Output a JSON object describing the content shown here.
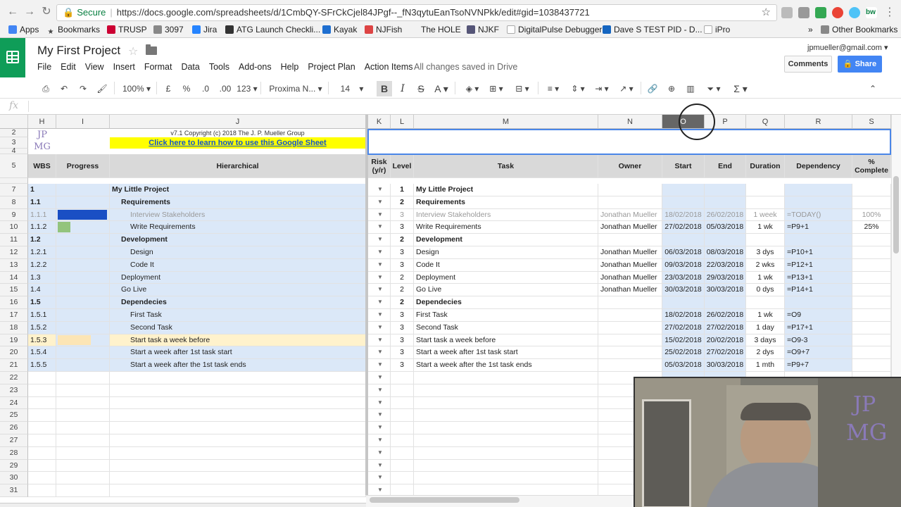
{
  "browser": {
    "secure_label": "Secure",
    "url": "https://docs.google.com/spreadsheets/d/1CmbQY-SFrCkCjel84JPgf--_fN3qytuEanTsoNVNPkk/edit#gid=1038437721",
    "bookmarks": [
      "Apps",
      "Bookmarks",
      "TRUSP",
      "3097",
      "Jira",
      "ATG Launch Checkli...",
      "Kayak",
      "NJFish",
      "The HOLE",
      "NJKF",
      "DigitalPulse Debugger",
      "Dave S TEST PID - D...",
      "iPro"
    ],
    "other_bookmarks": "Other Bookmarks",
    "more": "»"
  },
  "doc": {
    "title": "My First Project",
    "menus": [
      "File",
      "Edit",
      "View",
      "Insert",
      "Format",
      "Data",
      "Tools",
      "Add-ons",
      "Help",
      "Project Plan",
      "Action Items"
    ],
    "saved_status": "All changes saved in Drive",
    "account": "jpmueller@gmail.com",
    "comments_label": "Comments",
    "share_label": "Share"
  },
  "toolbar": {
    "zoom": "100%",
    "currency": "£",
    "percent": "%",
    "dec_less": ".0",
    "dec_more": ".00",
    "format_more": "123",
    "font": "Proxima N...",
    "font_size": "14",
    "bold": "B",
    "italic": "I",
    "strike": "S",
    "text_color": "A",
    "function": "Σ"
  },
  "formula_bar": {
    "fx": "fx"
  },
  "columns": [
    "H",
    "I",
    "J",
    "K",
    "L",
    "M",
    "N",
    "O",
    "P",
    "Q",
    "R",
    "S"
  ],
  "selected_column": "O",
  "header_block": {
    "logo_top": "JP",
    "logo_bottom": "MG",
    "copyright": "v7.1 Copyright (c) 2018 The J. P. Mueller Group",
    "link": "Click here to learn how to use this Google Sheet"
  },
  "table_headers": {
    "wbs": "WBS",
    "progress": "Progress",
    "hierarchical": "Hierarchical",
    "risk": "Risk (y/r)",
    "level": "Level",
    "task": "Task",
    "owner": "Owner",
    "start": "Start",
    "end": "End",
    "duration": "Duration",
    "dependency": "Dependency",
    "complete": "% Complete"
  },
  "rows": [
    {
      "n": "7",
      "wbs": "1",
      "hier": "My Little Project",
      "lvl": "1",
      "task": "My Little Project",
      "owner": "",
      "start": "",
      "end": "",
      "dur": "",
      "dep": "",
      "pct": "",
      "style": "b1"
    },
    {
      "n": "8",
      "wbs": "1.1",
      "hier": "Requirements",
      "lvl": "2",
      "task": "Requirements",
      "owner": "",
      "start": "",
      "end": "",
      "dur": "",
      "dep": "",
      "pct": "",
      "style": "b2"
    },
    {
      "n": "9",
      "wbs": "1.1.1",
      "hier": "Interview Stakeholders",
      "lvl": "3",
      "task": "Interview Stakeholders",
      "owner": "Jonathan Mueller",
      "start": "18/02/2018",
      "end": "26/02/2018",
      "dur": "1 week",
      "dep": "=TODAY()",
      "pct": "100%",
      "style": "gray",
      "progress": 1.0
    },
    {
      "n": "10",
      "wbs": "1.1.2",
      "hier": "Write Requirements",
      "lvl": "3",
      "task": "Write Requirements",
      "owner": "Jonathan Mueller",
      "start": "27/02/2018",
      "end": "05/03/2018",
      "dur": "1 wk",
      "dep": "=P9+1",
      "pct": "25%",
      "style": "n3",
      "progress": 0.25
    },
    {
      "n": "11",
      "wbs": "1.2",
      "hier": "Development",
      "lvl": "2",
      "task": "Development",
      "owner": "",
      "start": "",
      "end": "",
      "dur": "",
      "dep": "",
      "pct": "",
      "style": "b2"
    },
    {
      "n": "12",
      "wbs": "1.2.1",
      "hier": "Design",
      "lvl": "3",
      "task": "Design",
      "owner": "Jonathan Mueller",
      "start": "06/03/2018",
      "end": "08/03/2018",
      "dur": "3 dys",
      "dep": "=P10+1",
      "pct": "",
      "style": "n3"
    },
    {
      "n": "13",
      "wbs": "1.2.2",
      "hier": "Code It",
      "lvl": "3",
      "task": "Code It",
      "owner": "Jonathan Mueller",
      "start": "09/03/2018",
      "end": "22/03/2018",
      "dur": "2 wks",
      "dep": "=P12+1",
      "pct": "",
      "style": "n3"
    },
    {
      "n": "14",
      "wbs": "1.3",
      "hier": "Deployment",
      "lvl": "2",
      "task": "Deployment",
      "owner": "Jonathan Mueller",
      "start": "23/03/2018",
      "end": "29/03/2018",
      "dur": "1 wk",
      "dep": "=P13+1",
      "pct": "",
      "style": "n2"
    },
    {
      "n": "15",
      "wbs": "1.4",
      "hier": "Go Live",
      "lvl": "2",
      "task": "Go Live",
      "owner": "Jonathan Mueller",
      "start": "30/03/2018",
      "end": "30/03/2018",
      "dur": "0 dys",
      "dep": "=P14+1",
      "pct": "",
      "style": "n2"
    },
    {
      "n": "16",
      "wbs": "1.5",
      "hier": "Dependecies",
      "lvl": "2",
      "task": "Dependecies",
      "owner": "",
      "start": "",
      "end": "",
      "dur": "",
      "dep": "",
      "pct": "",
      "style": "b2"
    },
    {
      "n": "17",
      "wbs": "1.5.1",
      "hier": "First Task",
      "lvl": "3",
      "task": "First Task",
      "owner": "",
      "start": "18/02/2018",
      "end": "26/02/2018",
      "dur": "1 wk",
      "dep": "=O9",
      "pct": "",
      "style": "n3"
    },
    {
      "n": "18",
      "wbs": "1.5.2",
      "hier": "Second Task",
      "lvl": "3",
      "task": "Second Task",
      "owner": "",
      "start": "27/02/2018",
      "end": "27/02/2018",
      "dur": "1 day",
      "dep": "=P17+1",
      "pct": "",
      "style": "n3"
    },
    {
      "n": "19",
      "wbs": "1.5.3",
      "hier": "Start task a week before",
      "lvl": "3",
      "task": "Start task a week before",
      "owner": "",
      "start": "15/02/2018",
      "end": "20/02/2018",
      "dur": "3 days",
      "dep": "=O9-3",
      "pct": "",
      "style": "y3"
    },
    {
      "n": "20",
      "wbs": "1.5.4",
      "hier": "Start a week after 1st task start",
      "lvl": "3",
      "task": "Start a week after 1st task start",
      "owner": "",
      "start": "25/02/2018",
      "end": "27/02/2018",
      "dur": "2 dys",
      "dep": "=O9+7",
      "pct": "",
      "style": "n3"
    },
    {
      "n": "21",
      "wbs": "1.5.5",
      "hier": "Start a week after the 1st task ends",
      "lvl": "3",
      "task": "Start a week after the 1st task ends",
      "owner": "",
      "start": "05/03/2018",
      "end": "30/03/2018",
      "dur": "1 mth",
      "dep": "=P9+7",
      "pct": "",
      "style": "n3"
    }
  ],
  "empty_rows": [
    "22",
    "23",
    "24",
    "25",
    "26",
    "27",
    "28",
    "29",
    "30",
    "31"
  ],
  "top_rows": [
    "2",
    "3",
    "4",
    "5"
  ],
  "video_overlay": {
    "logo_top": "JP",
    "logo_bottom": "MG"
  },
  "colors": {
    "sheets_green": "#0f9d58",
    "share_blue": "#4285f4",
    "row_blue": "#dbe8f8",
    "link_yellow": "#ffff00",
    "progress_full": "#1a4fc4",
    "progress_partial": "#93c47d"
  }
}
